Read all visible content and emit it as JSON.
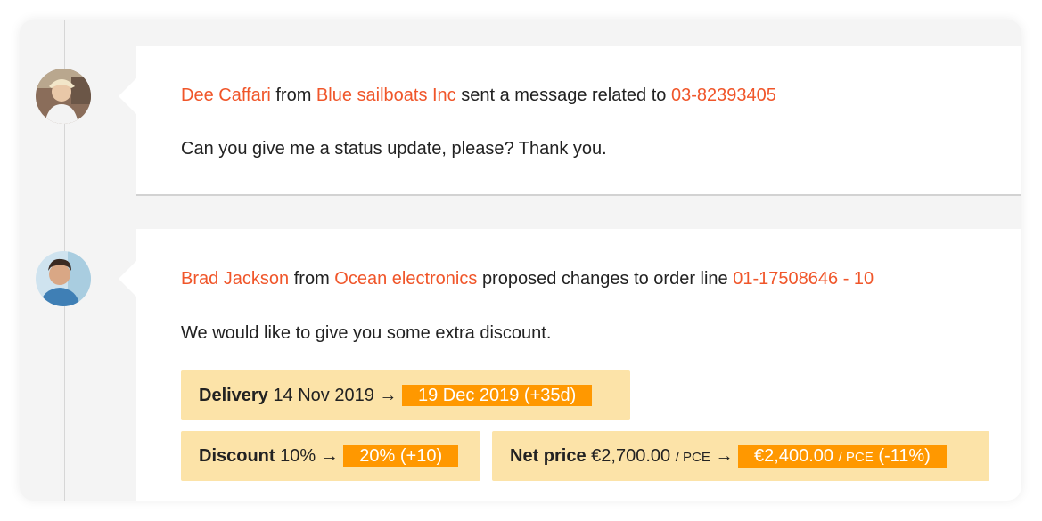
{
  "timeline": [
    {
      "person": "Dee Caffari",
      "from_word": "from",
      "company": "Blue sailboats Inc",
      "action": "sent a message related to",
      "reference": "03-82393405",
      "message": "Can you give me a status update, please? Thank you."
    },
    {
      "person": "Brad Jackson",
      "from_word": "from",
      "company": "Ocean electronics",
      "action": "proposed changes to order line",
      "reference": "01-17508646 - 10",
      "message": "We would like to give you some extra discount.",
      "changes": {
        "delivery": {
          "label": "Delivery",
          "old": "14 Nov 2019",
          "arrow": "→",
          "new": "19 Dec 2019 (+35d)"
        },
        "discount": {
          "label": "Discount",
          "old": "10%",
          "arrow": "→",
          "new": "20% (+10)"
        },
        "net_price": {
          "label": "Net price",
          "old": "€2,700.00",
          "unit": "/ PCE",
          "arrow": "→",
          "new": "€2,400.00",
          "new_unit": "/ PCE",
          "new_delta": "(-11%)"
        }
      }
    }
  ],
  "colors": {
    "accent": "#f0562a",
    "highlight": "#ff9800",
    "chip_bg": "#fce3a8"
  }
}
